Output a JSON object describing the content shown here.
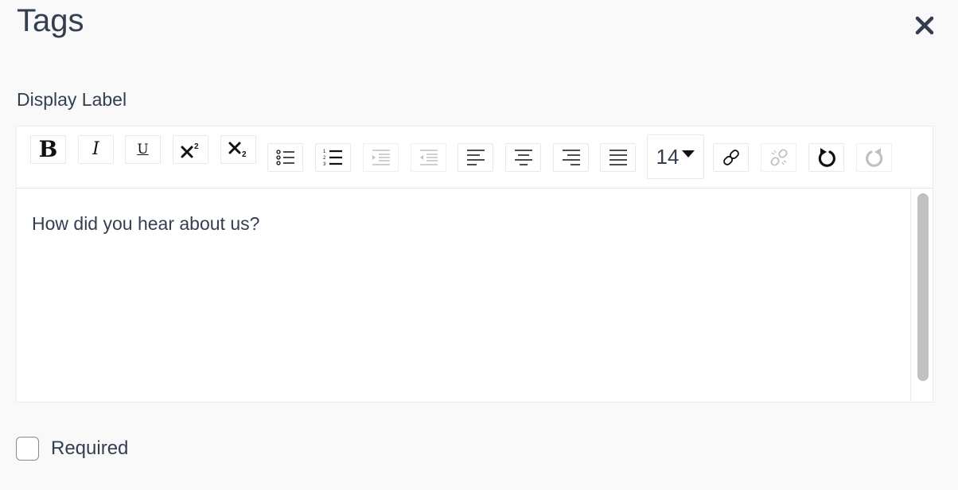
{
  "dialog": {
    "title": "Tags"
  },
  "field": {
    "label": "Display Label"
  },
  "toolbar": {
    "buttons": [
      {
        "name": "bold-button",
        "icon": "bold-icon"
      },
      {
        "name": "italic-button",
        "icon": "italic-icon"
      },
      {
        "name": "underline-button",
        "icon": "underline-icon"
      },
      {
        "name": "superscript-button",
        "icon": "superscript-icon"
      },
      {
        "name": "subscript-button",
        "icon": "subscript-icon"
      },
      {
        "name": "bullet-list-button",
        "icon": "bullet-list-icon"
      },
      {
        "name": "numbered-list-button",
        "icon": "numbered-list-icon"
      },
      {
        "name": "indent-button",
        "icon": "indent-icon",
        "disabled": true
      },
      {
        "name": "outdent-button",
        "icon": "outdent-icon",
        "disabled": true
      },
      {
        "name": "align-left-button",
        "icon": "align-left-icon"
      },
      {
        "name": "align-center-button",
        "icon": "align-center-icon"
      },
      {
        "name": "align-right-button",
        "icon": "align-right-icon"
      },
      {
        "name": "align-justify-button",
        "icon": "align-justify-icon"
      },
      {
        "name": "link-button",
        "icon": "link-icon"
      },
      {
        "name": "unlink-button",
        "icon": "unlink-icon",
        "disabled": true
      },
      {
        "name": "undo-button",
        "icon": "undo-icon"
      },
      {
        "name": "redo-button",
        "icon": "redo-icon",
        "disabled": true
      }
    ],
    "bold_glyph": "B",
    "italic_glyph": "I",
    "underline_glyph": "U",
    "font_size": "14"
  },
  "editor": {
    "content": "How did you hear about us?"
  },
  "required": {
    "label": "Required",
    "checked": false
  },
  "colors": {
    "text": "#333f50",
    "background": "#f9f9f9",
    "disabled_icon": "#c0c0c0"
  }
}
